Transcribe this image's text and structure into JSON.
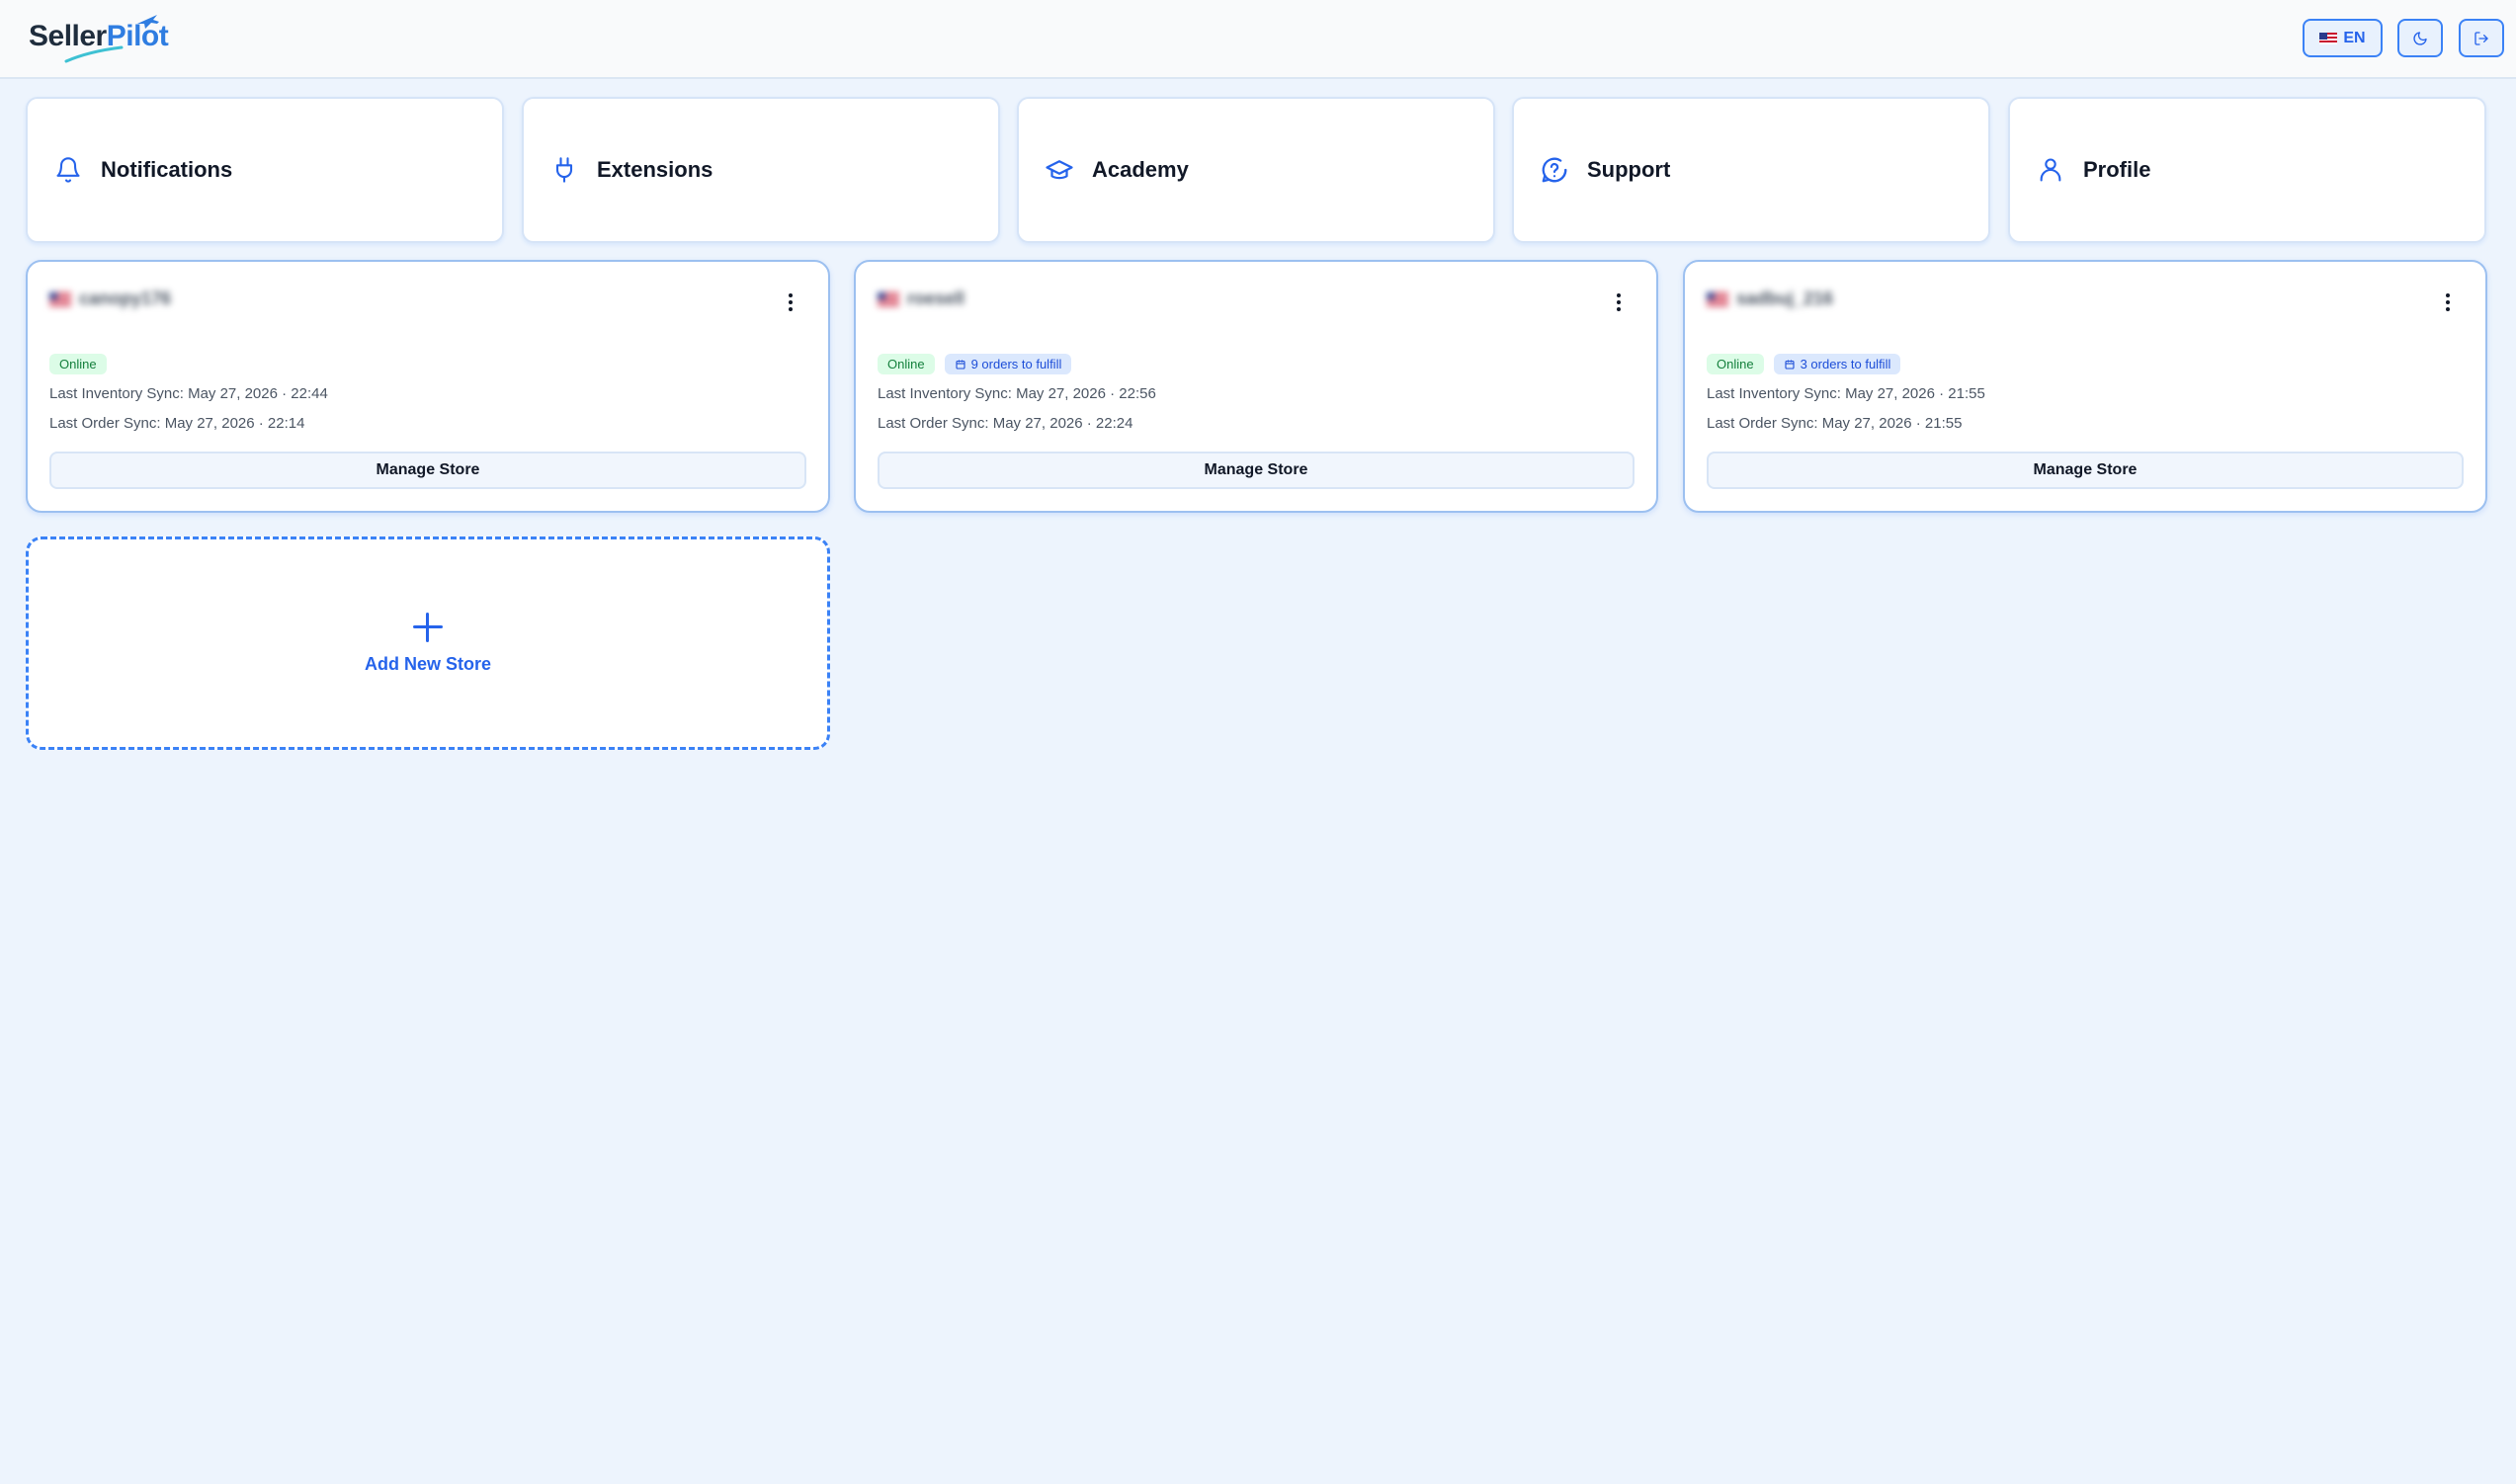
{
  "brand": {
    "part1": "Seller",
    "part2": "Pilot",
    "accent": "#2f7de1"
  },
  "header": {
    "language_label": "EN",
    "theme_icon": "moon-icon",
    "logout_icon": "logout-icon"
  },
  "nav": [
    {
      "label": "Notifications",
      "icon": "bell-icon"
    },
    {
      "label": "Extensions",
      "icon": "plug-icon"
    },
    {
      "label": "Academy",
      "icon": "graduation-cap-icon"
    },
    {
      "label": "Support",
      "icon": "help-chat-icon"
    },
    {
      "label": "Profile",
      "icon": "user-icon"
    }
  ],
  "stores": [
    {
      "name": "canopy176",
      "status": "Online",
      "orders_badge": "",
      "inventory_sync": "Last Inventory Sync: May 27, 2026 · 22:44",
      "order_sync": "Last Order Sync: May 27, 2026 · 22:14",
      "manage_label": "Manage Store"
    },
    {
      "name": "roesell",
      "status": "Online",
      "orders_badge": "9 orders to fulfill",
      "inventory_sync": "Last Inventory Sync: May 27, 2026 · 22:56",
      "order_sync": "Last Order Sync: May 27, 2026 · 22:24",
      "manage_label": "Manage Store"
    },
    {
      "name": "sadbuj_216",
      "status": "Online",
      "orders_badge": "3 orders to fulfill",
      "inventory_sync": "Last Inventory Sync: May 27, 2026 · 21:55",
      "order_sync": "Last Order Sync: May 27, 2026 · 21:55",
      "manage_label": "Manage Store"
    }
  ],
  "add_store": {
    "label": "Add New Store"
  },
  "colors": {
    "background": "#edf4fd",
    "primary": "#2563eb",
    "online": "#15803d"
  }
}
